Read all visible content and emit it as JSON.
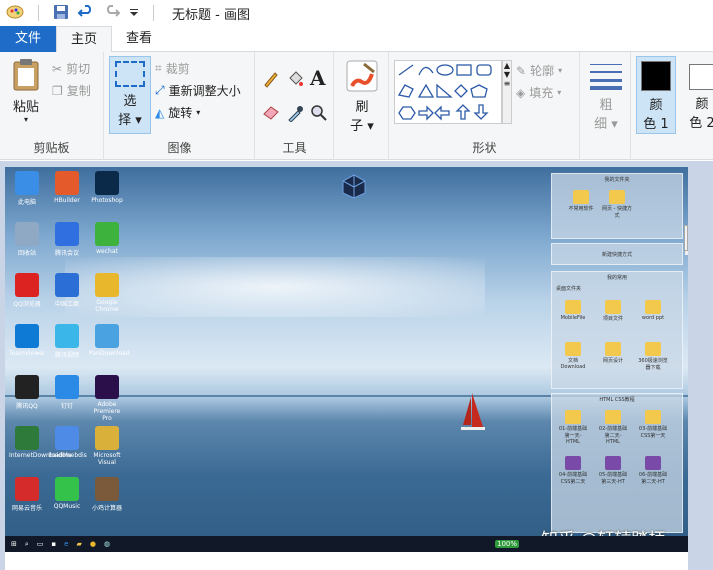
{
  "window": {
    "title": "无标题 - 画图"
  },
  "tabs": [
    {
      "label": "文件"
    },
    {
      "label": "主页"
    },
    {
      "label": "查看"
    }
  ],
  "clipboard": {
    "paste": "粘贴",
    "cut": "剪切",
    "copy": "复制",
    "group": "剪贴板"
  },
  "image_group": {
    "select": "选",
    "select2": "择",
    "crop": "裁剪",
    "resize": "重新调整大小",
    "rotate": "旋转",
    "group": "图像"
  },
  "tools": {
    "group": "工具",
    "text": "A"
  },
  "brush": {
    "l1": "刷",
    "l2": "子"
  },
  "shapes": {
    "outline": "轮廓",
    "fill": "填充",
    "group": "形状"
  },
  "size": {
    "l1": "粗",
    "l2": "细"
  },
  "colors": {
    "c1a": "颜",
    "c1b": "色 1",
    "c2a": "颜",
    "c2b": "色 2",
    "color1": "#000000",
    "color2": "#ffffff"
  },
  "desktop": {
    "icons": [
      {
        "label": "此电脑",
        "color": "#3a8ee6"
      },
      {
        "label": "HBuilder",
        "color": "#e45a2b"
      },
      {
        "label": "Photoshop",
        "color": "#0b2a4a"
      },
      {
        "label": "回收站",
        "color": "#8fa8c4"
      },
      {
        "label": "腾讯会议",
        "color": "#2f6fe0"
      },
      {
        "label": "wechat",
        "color": "#3db33d"
      },
      {
        "label": "QQ浏览器",
        "color": "#d22"
      },
      {
        "label": "中国工商",
        "color": "#2b6fd6"
      },
      {
        "label": "Google Chrome",
        "color": "#e8b72c"
      },
      {
        "label": "TeamViewer",
        "color": "#0e7ad6"
      },
      {
        "label": "腾讯视频",
        "color": "#3ab6e8"
      },
      {
        "label": "PanDownload",
        "color": "#4aa3e0"
      },
      {
        "label": "腾讯QQ",
        "color": "#222"
      },
      {
        "label": "钉钉",
        "color": "#2a8ae6"
      },
      {
        "label": "Adobe Premiere Pro",
        "color": "#2a0f4a"
      },
      {
        "label": "InternetDownloadMa",
        "color": "#2e7a3a"
      },
      {
        "label": "baiduwebdis",
        "color": "#4e8be6"
      },
      {
        "label": "Microsoft Visual",
        "color": "#d9b13a"
      },
      {
        "label": "网易云音乐",
        "color": "#d62b2b"
      },
      {
        "label": "QQMusic",
        "color": "#35c24b"
      },
      {
        "label": "小鸡计算器",
        "color": "#7a5a3a"
      }
    ],
    "panel_top_title": "我的文件夹",
    "panel_top_folders": [
      {
        "label": "不常用软件"
      },
      {
        "label": "网页 - 快捷方式"
      }
    ],
    "panel_mid_label": "新建快捷方式",
    "panel_desk_label": "我的常用",
    "panel_desk_sub": "桌面文件夹",
    "panel_desk_folders": [
      {
        "label": "MobileFile"
      },
      {
        "label": "项目文件"
      },
      {
        "label": "word ppt"
      },
      {
        "label": "文档Download"
      },
      {
        "label": "网页设计"
      },
      {
        "label": "360极速浏览器下载"
      }
    ],
    "panel_css_label": "HTML CSS教程",
    "panel_css_items": [
      {
        "label": "01-前端基础第一天-HTML"
      },
      {
        "label": "02-前端基础第二天-HTML"
      },
      {
        "label": "03-前端基础CSS第一天"
      },
      {
        "label": "04-前端基础CSS第二天"
      },
      {
        "label": "05-前端基础第三天-HT"
      },
      {
        "label": "06-前端基础第二天-HT"
      }
    ],
    "taskbar_battery": "100%",
    "watermark": "知乎 @轩辕踏柄"
  }
}
